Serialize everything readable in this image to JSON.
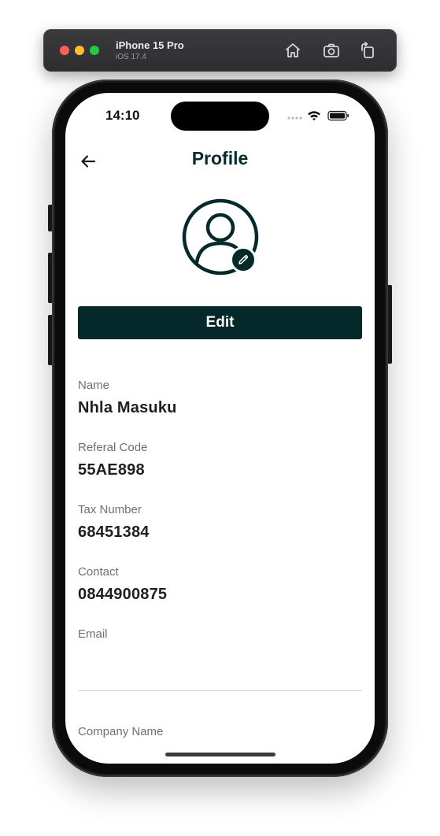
{
  "simulator": {
    "device_name": "iPhone 15 Pro",
    "os_version": "iOS 17.4",
    "home_icon": "home-icon",
    "screenshot_icon": "screenshot-icon",
    "rotate_icon": "rotate-icon"
  },
  "status_bar": {
    "time": "14:10",
    "signal_icon": "signal-dots-icon",
    "wifi_icon": "wifi-icon",
    "battery_icon": "battery-icon"
  },
  "header": {
    "back_icon": "arrow-left-icon",
    "title": "Profile"
  },
  "avatar": {
    "icon": "user-circle-icon",
    "edit_icon": "pencil-icon"
  },
  "edit_button": {
    "label": "Edit"
  },
  "fields": [
    {
      "label": "Name",
      "value": "Nhla Masuku"
    },
    {
      "label": "Referal Code",
      "value": "55AE898"
    },
    {
      "label": "Tax Number",
      "value": "68451384"
    },
    {
      "label": "Contact",
      "value": "0844900875"
    },
    {
      "label": "Email",
      "value": ""
    },
    {
      "label": "Company Name",
      "value": ""
    }
  ],
  "colors": {
    "brand_dark": "#05292b",
    "title_text": "#062c2e",
    "label_text": "#6f6f6f",
    "value_text": "#1f1f1f"
  }
}
